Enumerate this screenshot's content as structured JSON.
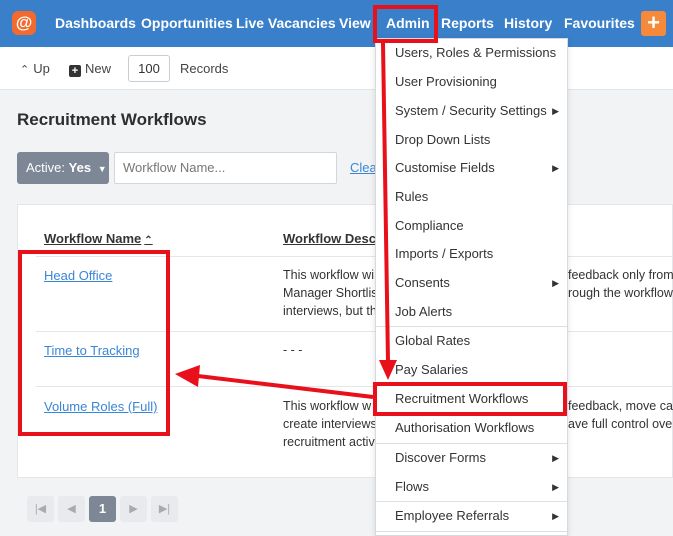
{
  "nav": {
    "logo": "@",
    "items": [
      "Dashboards",
      "Opportunities",
      "Live Vacancies",
      "View",
      "Admin",
      "Reports",
      "History",
      "Favourites"
    ],
    "add": "+"
  },
  "toolbar": {
    "up": "Up",
    "new": "New",
    "records_value": "100",
    "records_label": "Records"
  },
  "page": {
    "title": "Recruitment Workflows",
    "filter_label": "Active:",
    "filter_value": "Yes",
    "search_placeholder": "Workflow Name...",
    "clear": "Clear"
  },
  "table": {
    "columns": [
      "Workflow Name",
      "Workflow Descrip"
    ],
    "rows": [
      {
        "name": "Head Office",
        "desc": [
          "This workflow wi",
          "Manager Shortlis",
          "interviews, but th"
        ]
      },
      {
        "name": "Time to Tracking",
        "desc": [
          "- - -"
        ]
      },
      {
        "name": "Volume Roles (Full)",
        "desc": [
          "This workflow w",
          "create interviews",
          "recruitment activ"
        ]
      }
    ],
    "right_fragments": [
      "feedback only from",
      "rough the workflow",
      "feedback, move car",
      "ave full control over"
    ]
  },
  "pagination": {
    "first": "|◀",
    "prev": "◀",
    "current": "1",
    "next": "▶",
    "last": "▶|"
  },
  "admin_menu": [
    "Users, Roles & Permissions",
    "User Provisioning",
    "System / Security Settings",
    "Drop Down Lists",
    "Customise Fields",
    "Rules",
    "Compliance",
    "Imports / Exports",
    "Consents",
    "Job Alerts",
    "Global Rates",
    "Pay Salaries",
    "Recruitment Workflows",
    "Authorisation Workflows",
    "Discover Forms",
    "Flows",
    "Employee Referrals"
  ],
  "colors": {
    "nav_bg": "#3a7fc9",
    "annotation": "#e8101a",
    "link": "#3a86d6",
    "logo": "#f26a2e"
  }
}
